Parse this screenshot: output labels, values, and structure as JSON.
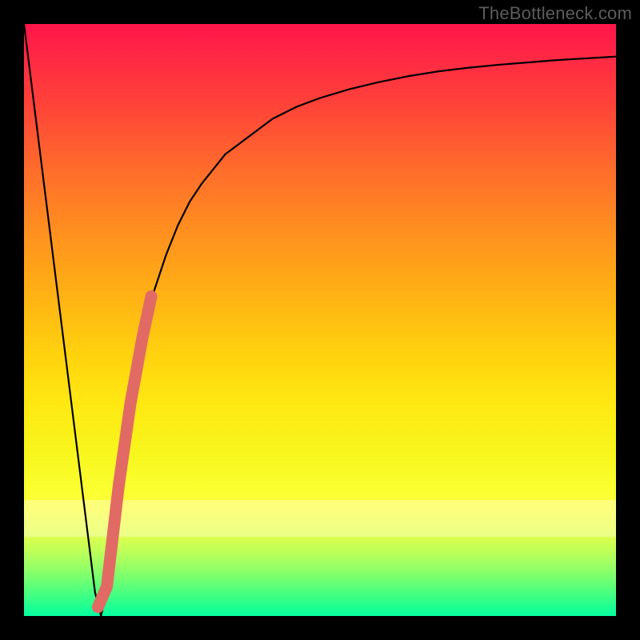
{
  "watermark": "TheBottleneck.com",
  "colors": {
    "frame": "#000000",
    "curve": "#000000",
    "highlight": "#e26a64",
    "gradient_top": "#ff154a",
    "gradient_bottom": "#06ffa1"
  },
  "chart_data": {
    "type": "line",
    "title": "",
    "xlabel": "",
    "ylabel": "",
    "xlim": [
      0,
      100
    ],
    "ylim": [
      0,
      100
    ],
    "series": [
      {
        "name": "bottleneck-curve",
        "x": [
          0,
          2,
          4,
          6,
          8,
          10,
          11,
          12,
          13,
          14,
          15,
          16,
          18,
          20,
          22,
          24,
          26,
          28,
          30,
          34,
          38,
          42,
          46,
          50,
          55,
          60,
          65,
          70,
          75,
          80,
          85,
          90,
          95,
          100
        ],
        "values": [
          100,
          84,
          68,
          52,
          36,
          20,
          12,
          4,
          0,
          4,
          13,
          22,
          36,
          47,
          55,
          61,
          66,
          70,
          73,
          78,
          81,
          84,
          86,
          87.5,
          89,
          90.2,
          91.2,
          92,
          92.6,
          93.1,
          93.5,
          93.9,
          94.2,
          94.5
        ]
      }
    ],
    "highlight_segment": {
      "name": "highlighted-range",
      "x": [
        12.5,
        14,
        16,
        18,
        20,
        21.5
      ],
      "values": [
        1.5,
        5,
        22,
        36,
        47,
        54
      ]
    },
    "translucent_strip_y": [
      13.4,
      19.6
    ]
  }
}
